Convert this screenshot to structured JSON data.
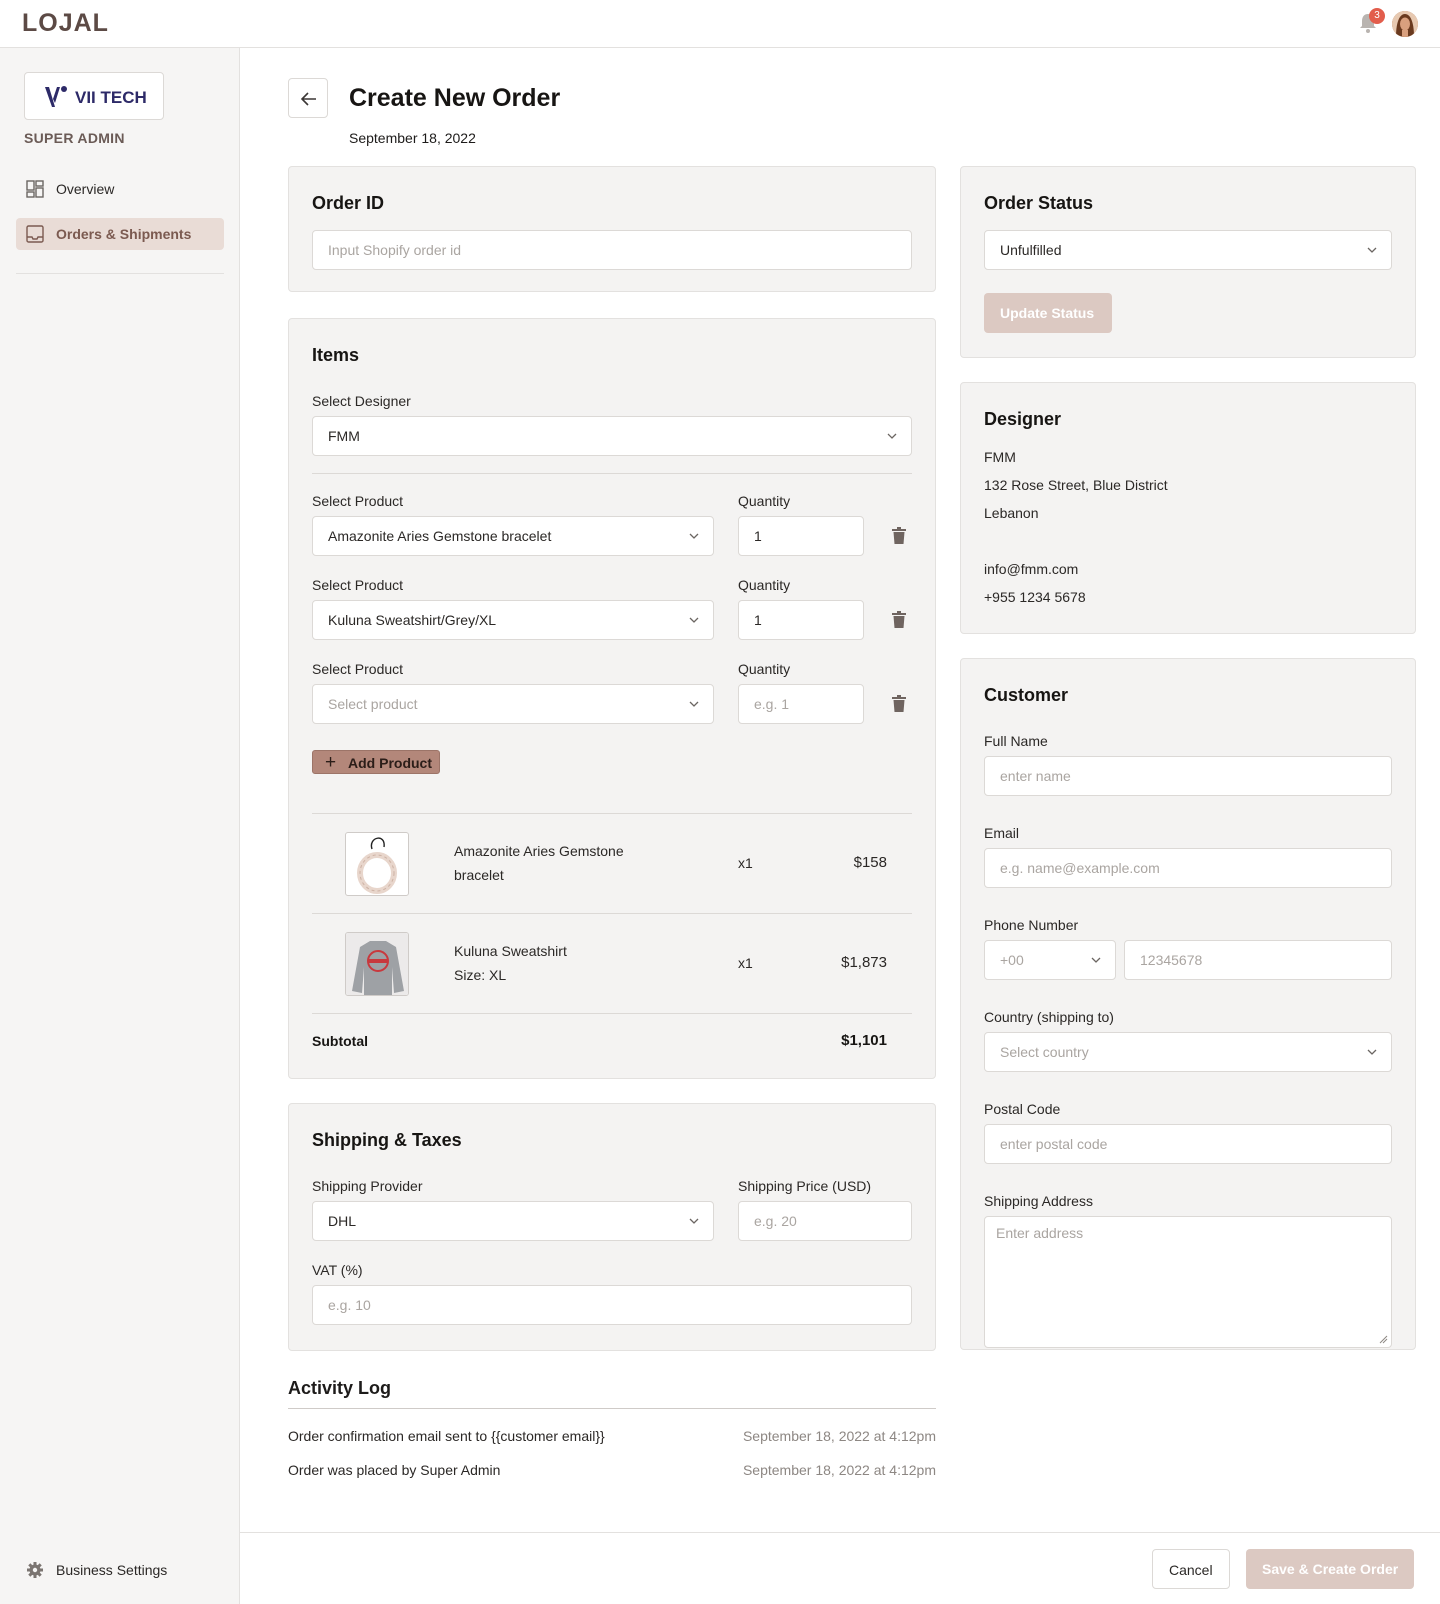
{
  "app": {
    "logo": "LOJAL",
    "notification_count": "3"
  },
  "sidebar": {
    "brand": "VII TECH",
    "role": "SUPER ADMIN",
    "items": [
      {
        "label": "Overview",
        "icon": "grid-icon"
      },
      {
        "label": "Orders & Shipments",
        "icon": "inbox-icon",
        "active": true
      }
    ],
    "settings_label": "Business Settings"
  },
  "header": {
    "title": "Create New Order",
    "date": "September 18, 2022"
  },
  "order_id": {
    "title": "Order ID",
    "placeholder": "Input Shopify order id"
  },
  "items": {
    "title": "Items",
    "designer_label": "Select Designer",
    "designer_value": "FMM",
    "product_label": "Select Product",
    "quantity_label": "Quantity",
    "rows": [
      {
        "product": "Amazonite Aries Gemstone bracelet",
        "quantity": "1"
      },
      {
        "product": "Kuluna Sweatshirt/Grey/XL",
        "quantity": "1"
      },
      {
        "product_placeholder": "Select product",
        "quantity_placeholder": "e.g. 1"
      }
    ],
    "add_product_label": "Add Product",
    "lines": [
      {
        "name_line1": "Amazonite Aries Gemstone",
        "name_line2": "bracelet",
        "qty": "x1",
        "price": "$158"
      },
      {
        "name_line1": "Kuluna Sweatshirt",
        "name_line2": "Size: XL",
        "qty": "x1",
        "price": "$1,873"
      }
    ],
    "subtotal_label": "Subtotal",
    "subtotal_value": "$1,101"
  },
  "shipping": {
    "title": "Shipping & Taxes",
    "provider_label": "Shipping Provider",
    "provider_value": "DHL",
    "price_label": "Shipping Price (USD)",
    "price_placeholder": "e.g. 20",
    "vat_label": "VAT (%)",
    "vat_placeholder": "e.g. 10"
  },
  "activity": {
    "title": "Activity Log",
    "entries": [
      {
        "text": "Order confirmation email sent to {{customer email}}",
        "time": "September 18, 2022 at 4:12pm"
      },
      {
        "text": "Order was placed by Super Admin",
        "time": "September 18, 2022 at 4:12pm"
      }
    ]
  },
  "status": {
    "title": "Order Status",
    "value": "Unfulfilled",
    "button": "Update Status"
  },
  "designer": {
    "title": "Designer",
    "name": "FMM",
    "address1": "132 Rose Street, Blue District",
    "address2": "Lebanon",
    "email": "info@fmm.com",
    "phone": "+955 1234 5678"
  },
  "customer": {
    "title": "Customer",
    "name_label": "Full Name",
    "name_placeholder": "enter name",
    "email_label": "Email",
    "email_placeholder": "e.g. name@example.com",
    "phone_label": "Phone Number",
    "phone_code_placeholder": "+00",
    "phone_placeholder": "12345678",
    "country_label": "Country (shipping to)",
    "country_placeholder": "Select country",
    "postal_label": "Postal Code",
    "postal_placeholder": "enter postal code",
    "address_label": "Shipping Address",
    "address_placeholder": "Enter address"
  },
  "footer": {
    "cancel": "Cancel",
    "save": "Save & Create Order"
  },
  "colors": {
    "accent": "#b3877a",
    "disabled_button": "#dcc9c2",
    "card_bg": "#f4f3f2",
    "badge": "#e25d4c"
  }
}
